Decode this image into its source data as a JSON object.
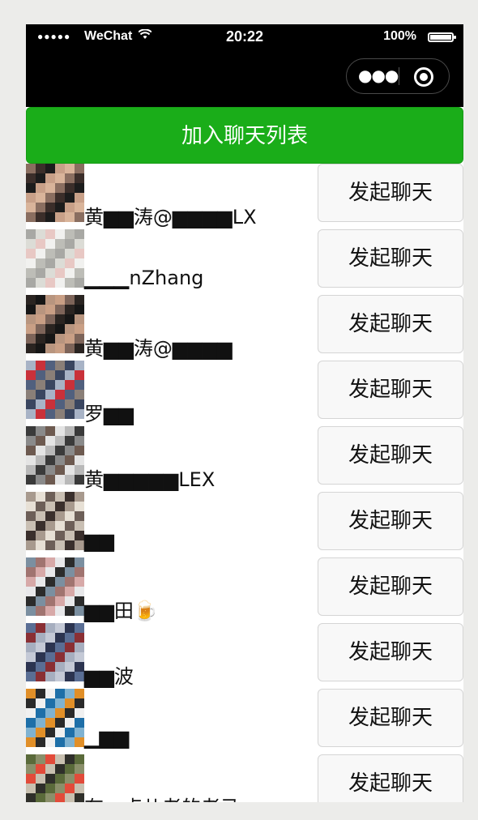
{
  "status_bar": {
    "signal": "●●●●●",
    "carrier": "WeChat",
    "time": "20:22",
    "battery": "100%"
  },
  "capsule": {
    "more_icon": "more-dots-icon",
    "close_icon": "close-circle-icon"
  },
  "join_button": "加入聊天列表",
  "colors": {
    "primary": "#1aad19",
    "bar": "#000000",
    "button_bg": "#f8f8f8"
  },
  "contacts": [
    {
      "name": "黄▆▆涛@▆▆▆▆LX",
      "button": "发起聊天"
    },
    {
      "name": "▁▁▁nZhang",
      "button": "发起聊天"
    },
    {
      "name": "黄▆▆涛@▆▆▆▆",
      "button": "发起聊天"
    },
    {
      "name": "罗▆▆",
      "button": "发起聊天"
    },
    {
      "name": "黄▆▆▆▆▆LEX",
      "button": "发起聊天"
    },
    {
      "name": "▆▆",
      "button": "发起聊天"
    },
    {
      "name": "▆▆田🍺",
      "button": "发起聊天"
    },
    {
      "name": "▆▆波",
      "button": "发起聊天"
    },
    {
      "name": "▁▆▆",
      "button": "发起聊天"
    },
    {
      "name": "有一点儿老的老马",
      "button": "发起聊天"
    }
  ]
}
